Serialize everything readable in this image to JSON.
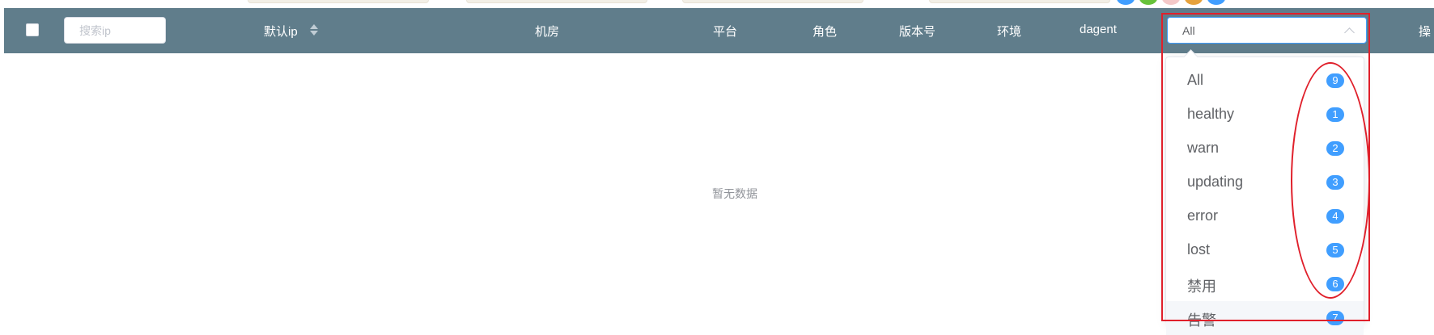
{
  "header": {
    "search_placeholder": "搜索ip",
    "columns": {
      "ip": "默认ip",
      "room": "机房",
      "platform": "平台",
      "role": "角色",
      "version": "版本号",
      "env": "环境",
      "dagent": "dagent",
      "ops": "操"
    },
    "status_select": {
      "value": "All",
      "options": [
        {
          "label": "All",
          "count": "9"
        },
        {
          "label": "healthy",
          "count": "1"
        },
        {
          "label": "warn",
          "count": "2"
        },
        {
          "label": "updating",
          "count": "3"
        },
        {
          "label": "error",
          "count": "4"
        },
        {
          "label": "lost",
          "count": "5"
        },
        {
          "label": "禁用",
          "count": "6"
        },
        {
          "label": "告警",
          "count": "7"
        }
      ]
    }
  },
  "table": {
    "empty_text": "暂无数据"
  },
  "colors": {
    "header_bg": "#607d8b",
    "accent": "#409eff",
    "annotation": "#e0202b"
  }
}
